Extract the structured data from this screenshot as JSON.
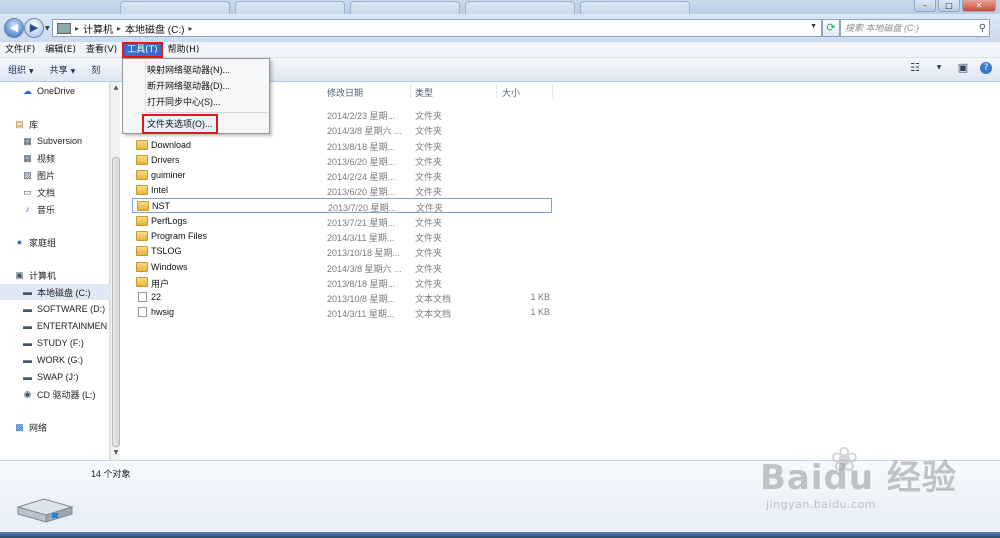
{
  "address": {
    "crumbs": [
      "计算机",
      "本地磁盘 (C:)"
    ],
    "search_placeholder": "搜索 本地磁盘 (C:)"
  },
  "menubar": [
    {
      "label": "文件(F)",
      "active": false
    },
    {
      "label": "编辑(E)",
      "active": false
    },
    {
      "label": "查看(V)",
      "active": false
    },
    {
      "label": "工具(T)",
      "active": true
    },
    {
      "label": "帮助(H)",
      "active": false
    }
  ],
  "toolbar": {
    "organize": "组织",
    "share": "共享",
    "burn_partial": "刻"
  },
  "tools_menu": {
    "items": [
      "映射网络驱动器(N)...",
      "断开网络驱动器(D)...",
      "打开同步中心(S)..."
    ],
    "highlighted": "文件夹选项(O)..."
  },
  "nav": {
    "onedrive": "OneDrive",
    "libraries": "库",
    "lib_items": [
      "Subversion",
      "视频",
      "图片",
      "文档",
      "音乐"
    ],
    "homegroup": "家庭组",
    "computer": "计算机",
    "drives": [
      "本地磁盘 (C:)",
      "SOFTWARE (D:)",
      "ENTERTAINMEN",
      "STUDY (F:)",
      "WORK (G:)",
      "SWAP (J:)",
      "CD 驱动器 (L:)"
    ],
    "network": "网络"
  },
  "columns": {
    "date": "修改日期",
    "type": "类型",
    "size": "大小"
  },
  "files": [
    {
      "name": "",
      "date": "2014/2/23 星期...",
      "type": "文件夹",
      "size": "",
      "kind": "folder"
    },
    {
      "name": "",
      "date": "2014/3/8 星期六 ...",
      "type": "文件夹",
      "size": "",
      "kind": "folder"
    },
    {
      "name": "Download",
      "date": "2013/8/18 星期...",
      "type": "文件夹",
      "size": "",
      "kind": "folder"
    },
    {
      "name": "Drivers",
      "date": "2013/6/20 星期...",
      "type": "文件夹",
      "size": "",
      "kind": "folder"
    },
    {
      "name": "guiminer",
      "date": "2014/2/24 星期...",
      "type": "文件夹",
      "size": "",
      "kind": "folder"
    },
    {
      "name": "Intel",
      "date": "2013/6/20 星期...",
      "type": "文件夹",
      "size": "",
      "kind": "folder"
    },
    {
      "name": "NST",
      "date": "2013/7/20 星期...",
      "type": "文件夹",
      "size": "",
      "kind": "folder"
    },
    {
      "name": "PerfLogs",
      "date": "2013/7/21 星期...",
      "type": "文件夹",
      "size": "",
      "kind": "folder"
    },
    {
      "name": "Program Files",
      "date": "2014/3/11 星期...",
      "type": "文件夹",
      "size": "",
      "kind": "folder"
    },
    {
      "name": "TSLOG",
      "date": "2013/10/18 星期...",
      "type": "文件夹",
      "size": "",
      "kind": "folder"
    },
    {
      "name": "Windows",
      "date": "2014/3/8 星期六 ...",
      "type": "文件夹",
      "size": "",
      "kind": "folder"
    },
    {
      "name": "用户",
      "date": "2013/8/18 星期...",
      "type": "文件夹",
      "size": "",
      "kind": "folder"
    },
    {
      "name": "22",
      "date": "2013/10/8 星期...",
      "type": "文本文档",
      "size": "1 KB",
      "kind": "file"
    },
    {
      "name": "hwsig",
      "date": "2014/3/11 星期...",
      "type": "文本文档",
      "size": "1 KB",
      "kind": "file"
    }
  ],
  "status": {
    "count": "14 个对象"
  },
  "watermark": {
    "logo": "Baidu 经验",
    "sub": "jingyan.baidu.com"
  },
  "colors": {
    "selection_outline": "#e01a1a",
    "menu_active": "#3a6cd0",
    "folder": "#e4b43c"
  }
}
